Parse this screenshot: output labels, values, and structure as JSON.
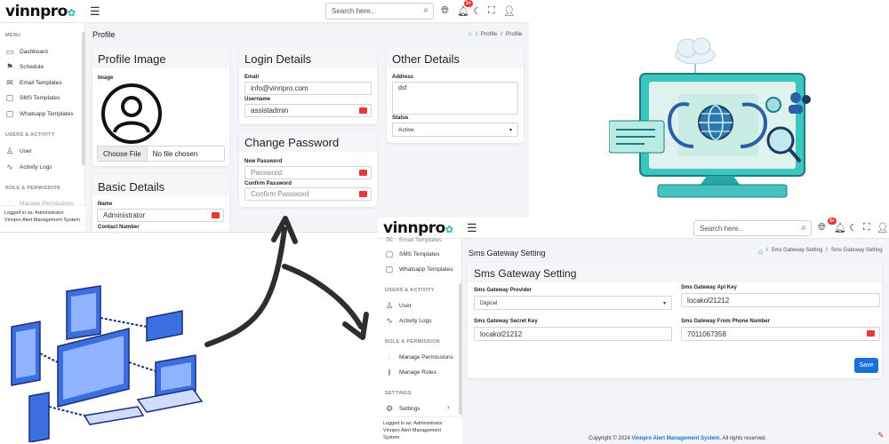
{
  "app": {
    "logo": "vinnpro"
  },
  "profile_screen": {
    "search_placeholder": "Search here..",
    "notification_badge": "3+",
    "page_title": "Profile",
    "breadcrumb": [
      "Profile",
      "Profile"
    ],
    "sidebar": {
      "menu_heading": "MENU",
      "items": [
        "Dashboard",
        "Schedule",
        "Email Templates",
        "SMS Templates",
        "Whatsapp Templates"
      ],
      "users_heading": "USERS & ACTIVITY",
      "user_items": [
        "User",
        "Activity Logs"
      ],
      "role_heading": "ROLE & PERMISSION",
      "role_items": [
        "Manage Permissions"
      ],
      "footer_line1": "Logged in as: Administrator",
      "footer_line2": "Vinnpro Alert Management System"
    },
    "profile_image": {
      "title": "Profile Image",
      "label": "Image",
      "choose_file": "Choose File",
      "file_status": "No file chosen"
    },
    "basic_details": {
      "title": "Basic Details",
      "name_label": "Name",
      "name_value": "Administrator",
      "contact_label": "Contact Number"
    },
    "login_details": {
      "title": "Login Details",
      "email_label": "Email",
      "email_value": "info@vinnpro.com",
      "username_label": "Username",
      "username_value": "assistadmin"
    },
    "change_password": {
      "title": "Change Password",
      "new_label": "New Password",
      "new_placeholder": "Password",
      "confirm_label": "Confirm Password",
      "confirm_placeholder": "Confirm Password"
    },
    "other_details": {
      "title": "Other Details",
      "address_label": "Address",
      "address_value": "dsf",
      "status_label": "Status",
      "status_value": "Active"
    }
  },
  "sms_screen": {
    "search_placeholder": "Search here..",
    "notification_badge": "3+",
    "page_title": "Sms Gateway Setting",
    "breadcrumb": [
      "Sms Gateway Setting",
      "Sms Gateway Setting"
    ],
    "sidebar": {
      "items_top": [
        "Email Templates",
        "SMS Templates",
        "Whatsapp Templates"
      ],
      "users_heading": "USERS & ACTIVITY",
      "user_items": [
        "User",
        "Activity Logs"
      ],
      "role_heading": "ROLE & PERMISSION",
      "role_items": [
        "Manage Permissions",
        "Manage Roles"
      ],
      "settings_heading": "SETTINGS",
      "settings_item": "Settings",
      "footer_line1": "Logged in as: Administrator",
      "footer_line2": "Vinnpro Alert Management",
      "footer_line3": "System"
    },
    "card_title": "Sms Gateway Setting",
    "provider_label": "Sms Gateway Provider",
    "provider_value": "Digicel",
    "api_key_label": "Sms Gateway Api Key",
    "api_key_value": "locakol21212",
    "secret_key_label": "Sms Gateway Secret Key",
    "secret_key_value": "locakol21212",
    "phone_label": "Sms Gateway From Phone Number",
    "phone_value": "7011067358",
    "save_label": "Save",
    "footer": {
      "prefix": "Copyright © 2024",
      "brand": "Vinnpro Alert Management System.",
      "suffix": "All rights reserved."
    }
  },
  "icons": [
    "bars-icon",
    "search-icon",
    "globe-icon",
    "bell-icon",
    "moon-icon",
    "fullscreen-icon",
    "user-icon",
    "home-icon",
    "key-icon"
  ],
  "colors": {
    "accent": "#1a6fd8",
    "teal": "#23b5a8",
    "red": "#e53935",
    "blue_line": "#2f6fe0"
  }
}
